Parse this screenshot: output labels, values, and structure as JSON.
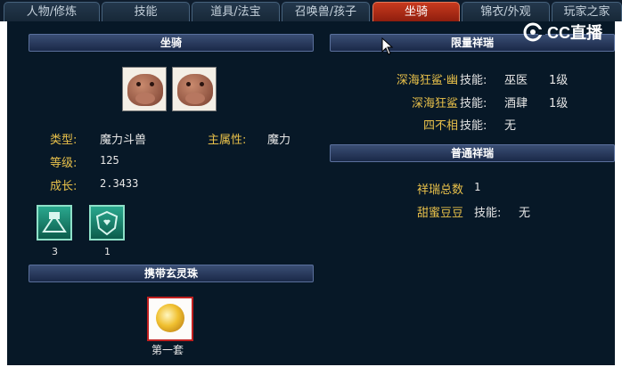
{
  "tabs": [
    "人物/修炼",
    "技能",
    "道具/法宝",
    "召唤兽/孩子",
    "坐骑",
    "锦衣/外观",
    "玩家之家"
  ],
  "active_tab_index": 4,
  "watermark": "CC直播",
  "mount_section": {
    "title": "坐骑",
    "type_label": "类型:",
    "type_value": "魔力斗兽",
    "main_attr_label": "主属性:",
    "main_attr_value": "魔力",
    "level_label": "等级:",
    "level_value": "125",
    "growth_label": "成长:",
    "growth_value": "2.3433",
    "skill_counts": [
      "3",
      "1"
    ]
  },
  "bead_section": {
    "title": "携带玄灵珠",
    "bead_label": "第一套"
  },
  "limited_section": {
    "title": "限量祥瑞",
    "entries": [
      {
        "name": "深海狂鲨·幽",
        "skill_label": "技能:",
        "skill": "巫医",
        "level": "1级"
      },
      {
        "name": "深海狂鲨",
        "skill_label": "技能:",
        "skill": "酒肆",
        "level": "1级"
      },
      {
        "name": "四不相",
        "skill_label": "技能:",
        "skill": "无",
        "level": ""
      }
    ]
  },
  "normal_section": {
    "title": "普通祥瑞",
    "total_label": "祥瑞总数",
    "total_value": "1",
    "entries": [
      {
        "name": "甜蜜豆豆",
        "skill_label": "技能:",
        "skill": "无"
      }
    ]
  },
  "colors": {
    "accent": "#e8c04a",
    "panel_bg": "#071827",
    "active_tab": "#b8301a"
  },
  "icons": [
    "skill-stamp-icon",
    "skill-shield-icon",
    "gold-bead-icon",
    "cursor-icon",
    "cc-logo-icon"
  ]
}
